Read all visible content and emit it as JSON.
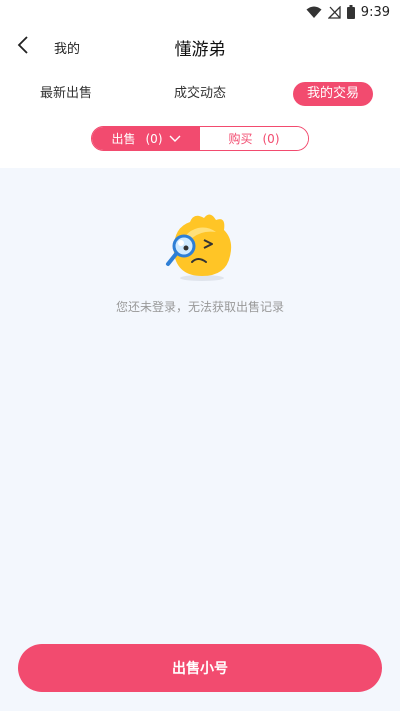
{
  "status_bar": {
    "time": "9:39",
    "icons": [
      "wifi-icon",
      "no-signal-icon",
      "battery-icon"
    ]
  },
  "nav": {
    "back_icon": "chevron-left-icon",
    "back_label": "我的",
    "title": "懂游弟"
  },
  "tabs": [
    {
      "label": "最新出售",
      "active": false
    },
    {
      "label": "成交动态",
      "active": false
    },
    {
      "label": "我的交易",
      "active": true
    }
  ],
  "segment": {
    "sell": {
      "label": "出售",
      "count": "(0)",
      "active": true,
      "icon": "chevron-down-icon"
    },
    "buy": {
      "label": "购买",
      "count": "(0)",
      "active": false
    }
  },
  "empty_state": {
    "illustration": "magnifier-mascot-icon",
    "message": "您还未登录，无法获取出售记录"
  },
  "footer": {
    "button_label": "出售小号"
  },
  "colors": {
    "accent": "#f24b6f",
    "content_bg": "#f3f7fd",
    "muted_text": "#999999"
  }
}
